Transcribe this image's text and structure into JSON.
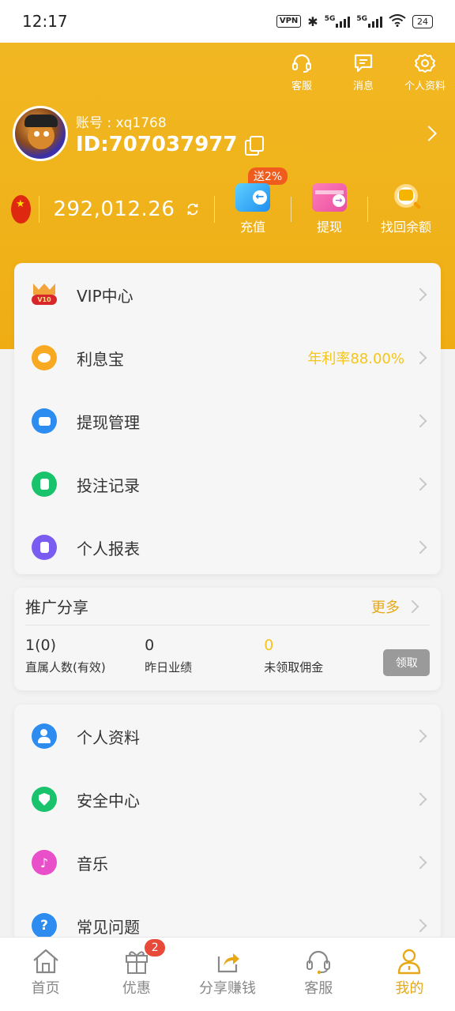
{
  "status": {
    "time": "12:17",
    "vpn": "VPN",
    "net1": "5G",
    "net2": "5G",
    "battery": "24"
  },
  "header": {
    "actions": [
      {
        "label": "客服",
        "icon": "headset-icon"
      },
      {
        "label": "消息",
        "icon": "message-icon"
      },
      {
        "label": "个人资料",
        "icon": "gear-icon"
      }
    ],
    "account_label": "账号 : xq1768",
    "id_label": "ID:707037977",
    "balance": "292,012.26",
    "wallet_actions": [
      {
        "label": "充值",
        "badge": "送2%"
      },
      {
        "label": "提现"
      },
      {
        "label": "找回余额"
      }
    ]
  },
  "menu1": [
    {
      "label": "VIP中心",
      "extra": ""
    },
    {
      "label": "利息宝",
      "extra": "年利率88.00%"
    },
    {
      "label": "提现管理",
      "extra": ""
    },
    {
      "label": "投注记录",
      "extra": ""
    },
    {
      "label": "个人报表",
      "extra": ""
    }
  ],
  "vip_badge": "V10",
  "share": {
    "title": "推广分享",
    "more": "更多",
    "stats": [
      {
        "value": "1(0)",
        "label": "直属人数(有效)"
      },
      {
        "value": "0",
        "label": "昨日业绩"
      },
      {
        "value": "0",
        "label": "未领取佣金"
      }
    ],
    "claim": "领取"
  },
  "menu2": [
    {
      "label": "个人资料"
    },
    {
      "label": "安全中心"
    },
    {
      "label": "音乐"
    },
    {
      "label": "常见问题"
    }
  ],
  "nav": [
    {
      "label": "首页"
    },
    {
      "label": "优惠",
      "badge": "2"
    },
    {
      "label": "分享赚钱"
    },
    {
      "label": "客服"
    },
    {
      "label": "我的"
    }
  ],
  "colors": {
    "brand": "#f0b21a",
    "accent": "#e6a817",
    "rate": "#f5c518"
  }
}
